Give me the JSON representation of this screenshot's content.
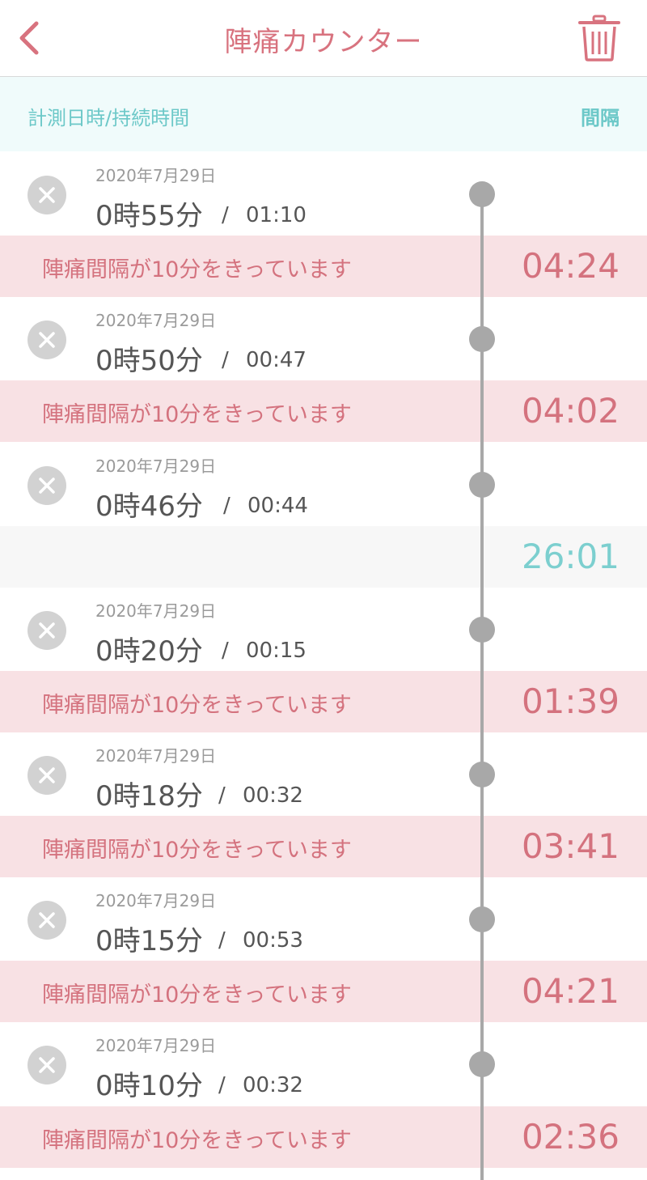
{
  "header": {
    "title": "陣痛カウンター",
    "back_icon": "chevron-left-icon",
    "trash_icon": "trash-icon",
    "accent_color": "#d8737f"
  },
  "columns": {
    "left": "計測日時/持続時間",
    "right": "間隔",
    "color": "#6cc8c8"
  },
  "entries": [
    {
      "date": "2020年7月29日",
      "time": "0時55分",
      "sep": "/",
      "duration": "01:10"
    },
    {
      "date": "2020年7月29日",
      "time": "0時50分",
      "sep": "/",
      "duration": "00:47"
    },
    {
      "date": "2020年7月29日",
      "time": "0時46分",
      "sep": "/",
      "duration": "00:44"
    },
    {
      "date": "2020年7月29日",
      "time": "0時20分",
      "sep": "/",
      "duration": "00:15"
    },
    {
      "date": "2020年7月29日",
      "time": "0時18分",
      "sep": "/",
      "duration": "00:32"
    },
    {
      "date": "2020年7月29日",
      "time": "0時15分",
      "sep": "/",
      "duration": "00:53"
    },
    {
      "date": "2020年7月29日",
      "time": "0時10分",
      "sep": "/",
      "duration": "00:32"
    }
  ],
  "intervals": [
    {
      "text": "陣痛間隔が10分をきっています",
      "value": "04:24",
      "kind": "warn"
    },
    {
      "text": "陣痛間隔が10分をきっています",
      "value": "04:02",
      "kind": "warn"
    },
    {
      "text": "",
      "value": "26:01",
      "kind": "gap"
    },
    {
      "text": "陣痛間隔が10分をきっています",
      "value": "01:39",
      "kind": "warn"
    },
    {
      "text": "陣痛間隔が10分をきっています",
      "value": "03:41",
      "kind": "warn"
    },
    {
      "text": "陣痛間隔が10分をきっています",
      "value": "04:21",
      "kind": "warn"
    },
    {
      "text": "陣痛間隔が10分をきっています",
      "value": "02:36",
      "kind": "warn"
    }
  ]
}
